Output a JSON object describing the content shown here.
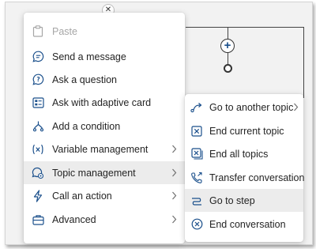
{
  "main_menu": {
    "items": [
      {
        "label": "Paste",
        "icon": "paste-icon",
        "disabled": true
      },
      {
        "label": "Send a message",
        "icon": "message-icon"
      },
      {
        "label": "Ask a question",
        "icon": "question-icon"
      },
      {
        "label": "Ask with adaptive card",
        "icon": "adaptive-card-icon"
      },
      {
        "label": "Add a condition",
        "icon": "branch-icon"
      },
      {
        "label": "Variable management",
        "icon": "variable-icon",
        "submenu": true
      },
      {
        "label": "Topic management",
        "icon": "topic-icon",
        "submenu": true,
        "selected": true
      },
      {
        "label": "Call an action",
        "icon": "lightning-icon",
        "submenu": true
      },
      {
        "label": "Advanced",
        "icon": "briefcase-icon",
        "submenu": true
      }
    ]
  },
  "sub_menu": {
    "items": [
      {
        "label": "Go to another topic",
        "icon": "redirect-icon",
        "submenu": true
      },
      {
        "label": "End current topic",
        "icon": "close-box-icon"
      },
      {
        "label": "End all topics",
        "icon": "close-all-icon"
      },
      {
        "label": "Transfer conversation",
        "icon": "phone-transfer-icon"
      },
      {
        "label": "Go to step",
        "icon": "go-to-step-icon",
        "selected": true
      },
      {
        "label": "End conversation",
        "icon": "close-circle-icon"
      }
    ]
  },
  "colors": {
    "accent": "#1a4f8b",
    "selected_bg": "#ececec",
    "disabled_text": "#a6a6a6"
  }
}
